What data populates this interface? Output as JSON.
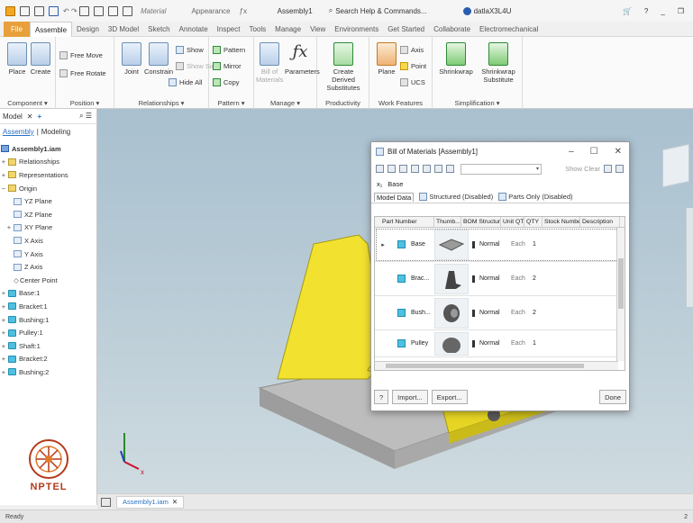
{
  "titlebar": {
    "material": "Material",
    "appearance": "Appearance",
    "document": "Assembly1",
    "search": "Search Help & Commands...",
    "user": "datlaX3L4U"
  },
  "ribbon_tabs": [
    "File",
    "Assemble",
    "Design",
    "3D Model",
    "Sketch",
    "Annotate",
    "Inspect",
    "Tools",
    "Manage",
    "View",
    "Environments",
    "Get Started",
    "Collaborate",
    "Electromechanical"
  ],
  "ribbon": {
    "place": "Place",
    "create": "Create",
    "free_move": "Free Move",
    "free_rotate": "Free Rotate",
    "joint": "Joint",
    "constrain": "Constrain",
    "show": "Show",
    "show_sick": "Show Sick",
    "hide_all": "Hide All",
    "pattern": "Pattern",
    "mirror": "Mirror",
    "copy": "Copy",
    "bill_of_materials": "Bill of Materials",
    "parameters": "Parameters",
    "create_derived": "Create Derived",
    "substitutes": "Substitutes",
    "plane": "Plane",
    "axis": "Axis",
    "point": "Point",
    "ucs": "UCS",
    "shrinkwrap": "Shrinkwrap",
    "shrinkwrap_substitute": "Shrinkwrap",
    "substitute": "Substitute",
    "panels": {
      "component": "Component ▾",
      "position": "Position ▾",
      "relationships": "Relationships ▾",
      "pattern": "Pattern ▾",
      "manage": "Manage ▾",
      "productivity": "Productivity",
      "work_features": "Work Features",
      "simplification": "Simplification ▾"
    }
  },
  "browser": {
    "header": "Model",
    "tabs": [
      "Assembly",
      "Modeling"
    ],
    "root": "Assembly1.iam",
    "nodes": [
      "Relationships",
      "Representations",
      "Origin",
      "YZ Plane",
      "XZ Plane",
      "XY Plane",
      "X Axis",
      "Y Axis",
      "Z Axis",
      "Center Point",
      "Base:1",
      "Bracket:1",
      "Bushing:1",
      "Pulley:1",
      "Shaft:1",
      "Bracket:2",
      "Bushing:2"
    ]
  },
  "bom": {
    "title": "Bill of Materials [Assembly1]",
    "show_clear": "Show Clear",
    "filter_value": "Base",
    "tabs": {
      "model_data": "Model Data",
      "structured": "Structured (Disabled)",
      "parts_only": "Parts Only (Disabled)"
    },
    "columns": [
      "Part Number",
      "Thumb...",
      "BOM Structure",
      "Unit QTY",
      "QTY",
      "Stock Number",
      "Description"
    ],
    "rows": [
      {
        "name": "Base",
        "structure": "Normal",
        "unit": "Each",
        "qty": "1"
      },
      {
        "name": "Brac...",
        "structure": "Normal",
        "unit": "Each",
        "qty": "2"
      },
      {
        "name": "Bush...",
        "structure": "Normal",
        "unit": "Each",
        "qty": "2"
      },
      {
        "name": "Pulley",
        "structure": "Normal",
        "unit": "Each",
        "qty": "1"
      }
    ],
    "import": "Import...",
    "export": "Export...",
    "done": "Done"
  },
  "doc_tab": "Assembly1.iam",
  "status": "Ready",
  "status_right": "2",
  "logo_text": "NPTEL",
  "colors": {
    "file_tab": "#e8a13a",
    "part_yellow": "#f2e12e",
    "part_gray": "#b9b9b9",
    "canvas_top": "#a9c0cf"
  }
}
